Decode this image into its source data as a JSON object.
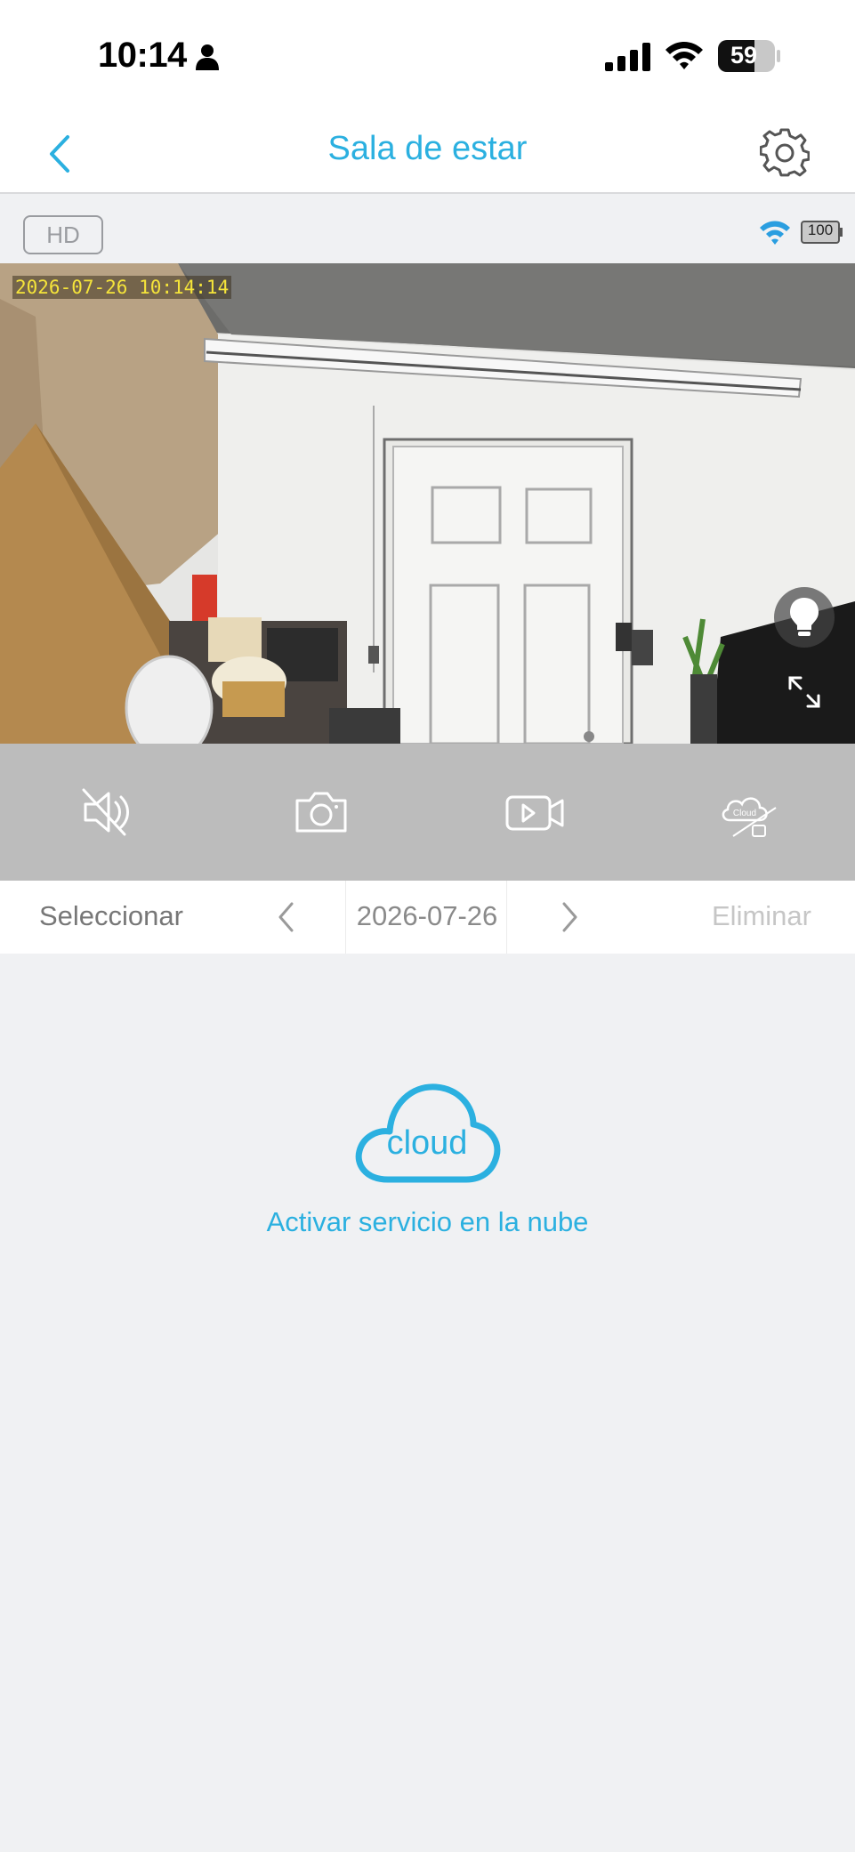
{
  "status_bar": {
    "time": "10:14",
    "battery_level": "59"
  },
  "nav": {
    "title": "Sala de estar"
  },
  "video": {
    "quality_label": "HD",
    "camera_battery": "100",
    "timestamp": "2026-07-26 10:14:14"
  },
  "controls": {
    "icons": [
      "mute-icon",
      "camera-snapshot-icon",
      "record-video-icon",
      "cloud-tf-icon"
    ]
  },
  "date_bar": {
    "select_label": "Seleccionar",
    "date": "2026-07-26",
    "delete_label": "Eliminar"
  },
  "cloud": {
    "icon_label": "cloud",
    "activate_label": "Activar servicio en la nube"
  },
  "colors": {
    "accent": "#2bb0e0",
    "background": "#f0f1f3",
    "controls_bg": "#bcbcbc"
  }
}
